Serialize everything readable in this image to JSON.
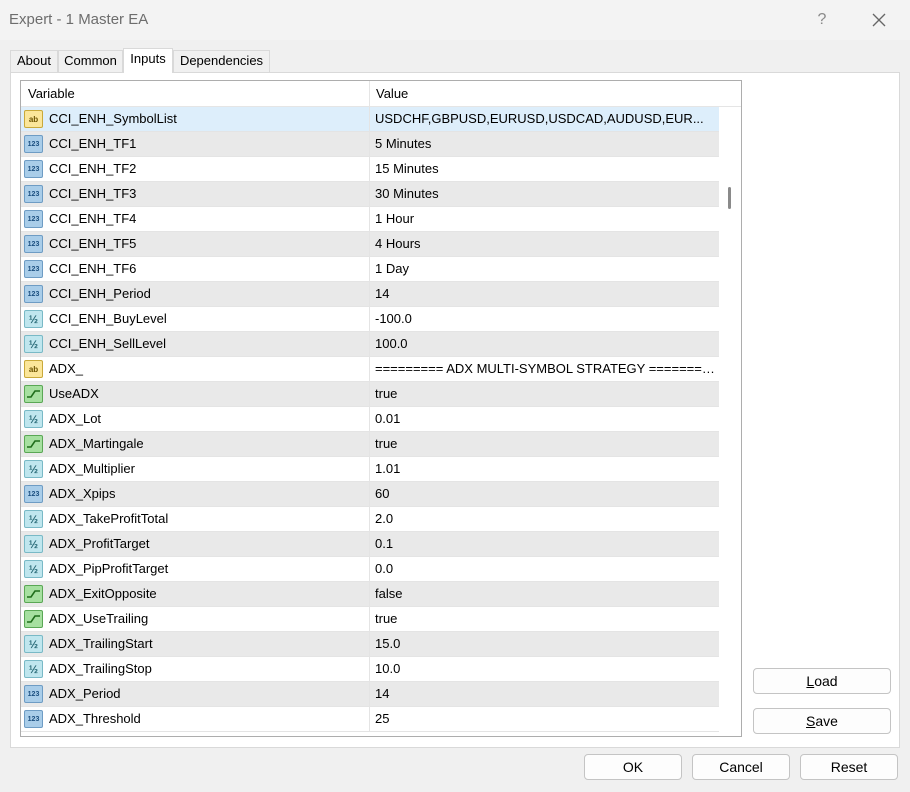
{
  "window": {
    "title": "Expert - 1 Master EA",
    "help_label": "?"
  },
  "tabs": [
    {
      "label": "About",
      "active": false
    },
    {
      "label": "Common",
      "active": false
    },
    {
      "label": "Inputs",
      "active": true
    },
    {
      "label": "Dependencies",
      "active": false
    }
  ],
  "table": {
    "headers": {
      "variable": "Variable",
      "value": "Value"
    },
    "rows": [
      {
        "icon": "ab",
        "variable": "CCI_ENH_SymbolList",
        "value": "USDCHF,GBPUSD,EURUSD,USDCAD,AUDUSD,EUR..."
      },
      {
        "icon": "123",
        "variable": "CCI_ENH_TF1",
        "value": "5 Minutes"
      },
      {
        "icon": "123",
        "variable": "CCI_ENH_TF2",
        "value": "15 Minutes"
      },
      {
        "icon": "123",
        "variable": "CCI_ENH_TF3",
        "value": "30 Minutes"
      },
      {
        "icon": "123",
        "variable": "CCI_ENH_TF4",
        "value": "1 Hour"
      },
      {
        "icon": "123",
        "variable": "CCI_ENH_TF5",
        "value": "4 Hours"
      },
      {
        "icon": "123",
        "variable": "CCI_ENH_TF6",
        "value": "1 Day"
      },
      {
        "icon": "123",
        "variable": "CCI_ENH_Period",
        "value": "14"
      },
      {
        "icon": "1/2",
        "variable": "CCI_ENH_BuyLevel",
        "value": "-100.0"
      },
      {
        "icon": "1/2",
        "variable": "CCI_ENH_SellLevel",
        "value": "100.0"
      },
      {
        "icon": "ab",
        "variable": "ADX_",
        "value": "========= ADX MULTI-SYMBOL STRATEGY ========="
      },
      {
        "icon": "bool",
        "variable": "UseADX",
        "value": "true"
      },
      {
        "icon": "1/2",
        "variable": "ADX_Lot",
        "value": "0.01"
      },
      {
        "icon": "bool",
        "variable": "ADX_Martingale",
        "value": "true"
      },
      {
        "icon": "1/2",
        "variable": "ADX_Multiplier",
        "value": "1.01"
      },
      {
        "icon": "123",
        "variable": "ADX_Xpips",
        "value": "60"
      },
      {
        "icon": "1/2",
        "variable": "ADX_TakeProfitTotal",
        "value": "2.0"
      },
      {
        "icon": "1/2",
        "variable": "ADX_ProfitTarget",
        "value": "0.1"
      },
      {
        "icon": "1/2",
        "variable": "ADX_PipProfitTarget",
        "value": "0.0"
      },
      {
        "icon": "bool",
        "variable": "ADX_ExitOpposite",
        "value": "false"
      },
      {
        "icon": "bool",
        "variable": "ADX_UseTrailing",
        "value": "true"
      },
      {
        "icon": "1/2",
        "variable": "ADX_TrailingStart",
        "value": "15.0"
      },
      {
        "icon": "1/2",
        "variable": "ADX_TrailingStop",
        "value": "10.0"
      },
      {
        "icon": "123",
        "variable": "ADX_Period",
        "value": "14"
      },
      {
        "icon": "123",
        "variable": "ADX_Threshold",
        "value": "25"
      }
    ],
    "selected_index": 0
  },
  "buttons": {
    "load": {
      "access_key": "L",
      "rest": "oad"
    },
    "save": {
      "access_key": "S",
      "rest": "ave"
    },
    "ok": "OK",
    "cancel": "Cancel",
    "reset": "Reset"
  }
}
